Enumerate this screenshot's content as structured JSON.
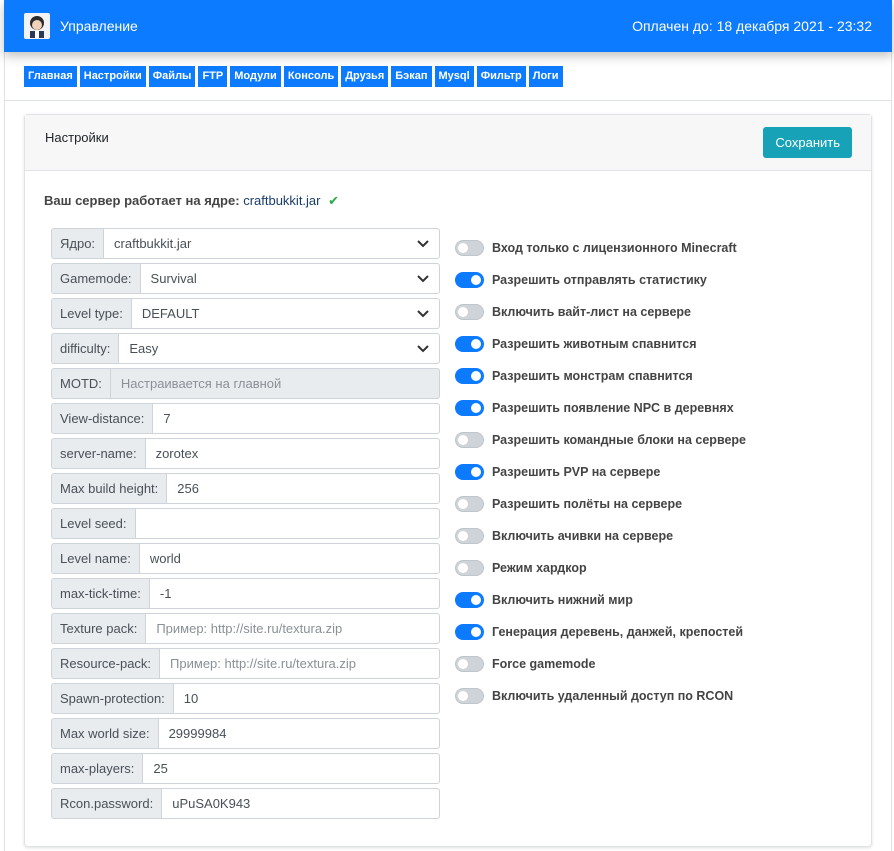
{
  "header": {
    "title": "Управление",
    "paid_until": "Оплачен до: 18 декабря 2021 - 23:32"
  },
  "nav": [
    "Главная",
    "Настройки",
    "Файлы",
    "FTP",
    "Модули",
    "Консоль",
    "Друзья",
    "Бэкап",
    "Mysql",
    "Фильтр",
    "Логи"
  ],
  "card": {
    "title": "Настройки",
    "save_label": "Сохранить",
    "core_prefix": "Ваш сервер работает на ядре:",
    "core_value": "craftbukkit.jar"
  },
  "fields": [
    {
      "label": "Ядро:",
      "value": "craftbukkit.jar",
      "type": "select"
    },
    {
      "label": "Gamemode:",
      "value": "Survival",
      "type": "select"
    },
    {
      "label": "Level type:",
      "value": "DEFAULT",
      "type": "select"
    },
    {
      "label": "difficulty:",
      "value": "Easy",
      "type": "select"
    },
    {
      "label": "MOTD:",
      "value": "Настраивается на главной",
      "type": "disabled"
    },
    {
      "label": "View-distance:",
      "value": "7",
      "type": "input"
    },
    {
      "label": "server-name:",
      "value": "zorotex",
      "type": "input"
    },
    {
      "label": "Max build height:",
      "value": "256",
      "type": "input"
    },
    {
      "label": "Level seed:",
      "value": "",
      "type": "input"
    },
    {
      "label": "Level name:",
      "value": "world",
      "type": "input"
    },
    {
      "label": "max-tick-time:",
      "value": "-1",
      "type": "input"
    },
    {
      "label": "Texture pack:",
      "value": "Пример: http://site.ru/textura.zip",
      "type": "placeholder"
    },
    {
      "label": "Resource-pack:",
      "value": "Пример: http://site.ru/textura.zip",
      "type": "placeholder"
    },
    {
      "label": "Spawn-protection:",
      "value": "10",
      "type": "input"
    },
    {
      "label": "Max world size:",
      "value": "29999984",
      "type": "input"
    },
    {
      "label": "max-players:",
      "value": "25",
      "type": "input"
    },
    {
      "label": "Rcon.password:",
      "value": "uPuSA0K943",
      "type": "input"
    }
  ],
  "toggles": [
    {
      "label": "Вход только с лицензионного Minecraft",
      "on": false
    },
    {
      "label": "Разрешить отправлять статистику",
      "on": true
    },
    {
      "label": "Включить вайт-лист на сервере",
      "on": false
    },
    {
      "label": "Разрешить животным спавнится",
      "on": true
    },
    {
      "label": "Разрешить монстрам спавнится",
      "on": true
    },
    {
      "label": "Разрешить появление NPC в деревнях",
      "on": true
    },
    {
      "label": "Разрешить командные блоки на сервере",
      "on": false
    },
    {
      "label": "Разрешить PVP на сервере",
      "on": true
    },
    {
      "label": "Разрешить полёты на сервере",
      "on": false
    },
    {
      "label": "Включить ачивки на сервере",
      "on": false
    },
    {
      "label": "Режим хардкор",
      "on": false
    },
    {
      "label": "Включить нижний мир",
      "on": true
    },
    {
      "label": "Генерация деревень, данжей, крепостей",
      "on": true
    },
    {
      "label": "Force gamemode",
      "on": false
    },
    {
      "label": "Включить удаленный доступ по RCON",
      "on": false
    }
  ]
}
